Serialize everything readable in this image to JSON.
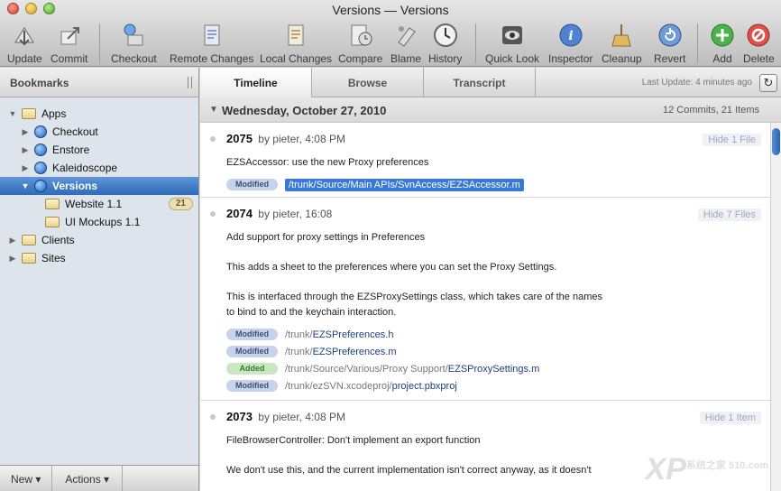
{
  "window": {
    "title": "Versions — Versions"
  },
  "toolbar": {
    "items": [
      {
        "label": "Update",
        "icon": "update-icon"
      },
      {
        "label": "Commit",
        "icon": "commit-icon"
      },
      {
        "label": "Checkout",
        "icon": "checkout-icon"
      },
      {
        "label": "Remote Changes",
        "icon": "remote-changes-icon"
      },
      {
        "label": "Local Changes",
        "icon": "local-changes-icon"
      },
      {
        "label": "Compare",
        "icon": "compare-icon"
      },
      {
        "label": "Blame",
        "icon": "blame-icon"
      },
      {
        "label": "History",
        "icon": "history-icon"
      },
      {
        "label": "Quick Look",
        "icon": "quick-look-icon"
      },
      {
        "label": "Inspector",
        "icon": "inspector-icon"
      },
      {
        "label": "Cleanup",
        "icon": "cleanup-icon"
      },
      {
        "label": "Revert",
        "icon": "revert-icon"
      },
      {
        "label": "Add",
        "icon": "add-icon"
      },
      {
        "label": "Delete",
        "icon": "delete-icon"
      }
    ]
  },
  "sidebar": {
    "header": "Bookmarks",
    "tree": [
      {
        "label": "Apps",
        "type": "folder",
        "level": 0,
        "expanded": true
      },
      {
        "label": "Checkout",
        "type": "repo",
        "level": 1
      },
      {
        "label": "Enstore",
        "type": "repo",
        "level": 1
      },
      {
        "label": "Kaleidoscope",
        "type": "repo",
        "level": 1
      },
      {
        "label": "Versions",
        "type": "repo",
        "level": 1,
        "expanded": true,
        "selected": true
      },
      {
        "label": "Website 1.1",
        "type": "folder",
        "level": 2,
        "badge": "21"
      },
      {
        "label": "UI Mockups 1.1",
        "type": "folder",
        "level": 2
      },
      {
        "label": "Clients",
        "type": "folder",
        "level": 0
      },
      {
        "label": "Sites",
        "type": "folder",
        "level": 0
      }
    ],
    "footer": {
      "new_label": "New ▾",
      "actions_label": "Actions ▾"
    }
  },
  "main": {
    "tabs": [
      {
        "label": "Timeline",
        "active": true
      },
      {
        "label": "Browse"
      },
      {
        "label": "Transcript"
      }
    ],
    "last_update": "Last Update: 4 minutes ago",
    "day": {
      "title": "Wednesday, October 27, 2010",
      "count": "12 Commits, 21 Items"
    },
    "commits": [
      {
        "rev": "2075",
        "meta": "by pieter, 4:08 PM",
        "hide_label": "Hide 1 File",
        "message": [
          "EZSAccessor: use the new Proxy preferences"
        ],
        "files": [
          {
            "status": "Modified",
            "dir": "/trunk/Source/Main APIs/SvnAccess/",
            "file": "EZSAccessor.m",
            "highlight": true
          }
        ]
      },
      {
        "rev": "2074",
        "meta": "by pieter, 16:08",
        "hide_label": "Hide 7 Files",
        "message": [
          "Add support for proxy settings in Preferences",
          "This adds a sheet to the preferences where you can set the Proxy Settings.",
          "This is interfaced through the EZSProxySettings class, which takes care of the names to bind to and the keychain interaction."
        ],
        "files": [
          {
            "status": "Modified",
            "dir": "/trunk/",
            "file": "EZSPreferences.h"
          },
          {
            "status": "Modified",
            "dir": "/trunk/",
            "file": "EZSPreferences.m"
          },
          {
            "status": "Added",
            "dir": "/trunk/Source/Various/Proxy Support/",
            "file": "EZSProxySettings.m"
          },
          {
            "status": "Modified",
            "dir": "/trunk/ezSVN.xcodeproj/",
            "file": "project.pbxproj"
          }
        ]
      },
      {
        "rev": "2073",
        "meta": "by pieter, 4:08 PM",
        "hide_label": "Hide 1 Item",
        "message": [
          "FileBrowserController: Don't implement an export function",
          "We don't use this, and the current implementation isn't correct anyway, as it doesn't"
        ],
        "files": []
      }
    ]
  },
  "watermark": {
    "text": "XP",
    "sub": "系统之家 510.com"
  }
}
